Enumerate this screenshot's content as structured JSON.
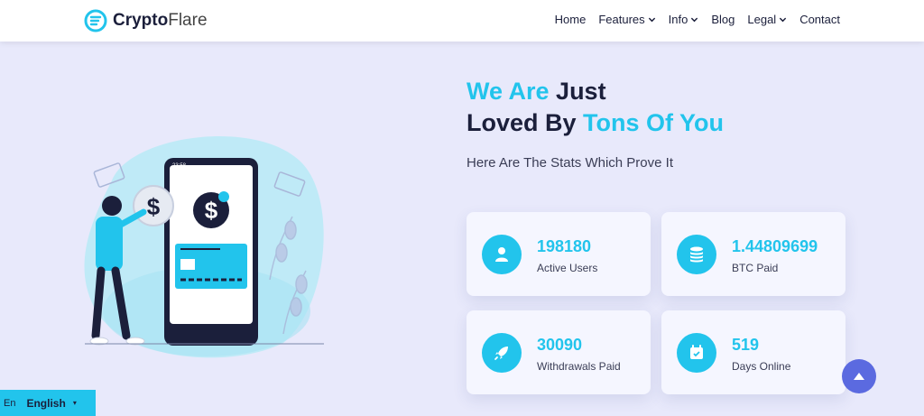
{
  "brand": {
    "name_bold": "Crypto",
    "name_light": "Flare"
  },
  "nav": {
    "items": [
      {
        "label": "Home",
        "dropdown": false
      },
      {
        "label": "Features",
        "dropdown": true
      },
      {
        "label": "Info",
        "dropdown": true
      },
      {
        "label": "Blog",
        "dropdown": false
      },
      {
        "label": "Legal",
        "dropdown": true
      },
      {
        "label": "Contact",
        "dropdown": false
      }
    ]
  },
  "hero": {
    "heading_part1": "We Are",
    "heading_part2": " Just",
    "heading_part3": "Loved By ",
    "heading_part4": "Tons Of You",
    "subheading": "Here Are The Stats Which Prove It",
    "phone_time": "23:58"
  },
  "stats": [
    {
      "value": "198180",
      "label": "Active Users",
      "icon": "user-icon"
    },
    {
      "value": "1.44809699",
      "label": "BTC Paid",
      "icon": "coins-icon"
    },
    {
      "value": "30090",
      "label": "Withdrawals Paid",
      "icon": "rocket-icon"
    },
    {
      "value": "519",
      "label": "Days Online",
      "icon": "calendar-icon"
    }
  ],
  "language": {
    "flag_alt": "En",
    "name": "English",
    "caret": "▾"
  },
  "colors": {
    "accent": "#22c4ec",
    "dark": "#1b1f3b",
    "background": "#e8e9fb",
    "scroll_button": "#5b6ae0"
  }
}
